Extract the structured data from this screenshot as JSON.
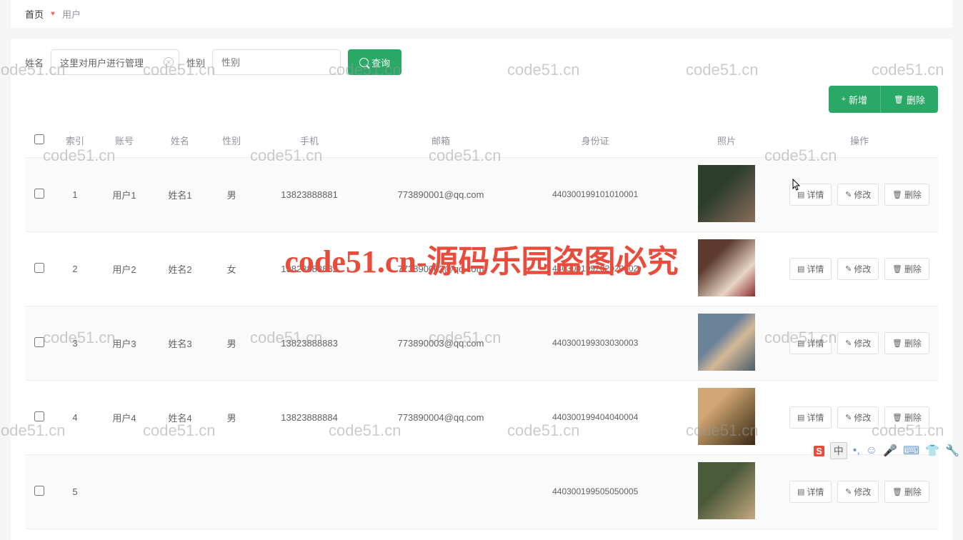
{
  "breadcrumb": {
    "home": "首页",
    "current": "用户"
  },
  "search": {
    "name_label": "姓名",
    "name_value": "这里对用户进行管理",
    "gender_label": "性别",
    "gender_placeholder": "性别",
    "query_btn": "查询"
  },
  "toolbar": {
    "add": "新增",
    "delete": "删除"
  },
  "columns": {
    "index": "索引",
    "account": "账号",
    "name": "姓名",
    "gender": "性别",
    "phone": "手机",
    "email": "邮箱",
    "idcard": "身份证",
    "photo": "照片",
    "action": "操作"
  },
  "row_actions": {
    "detail": "详情",
    "edit": "修改",
    "delete": "删除"
  },
  "rows": [
    {
      "index": "1",
      "account": "用户1",
      "name": "姓名1",
      "gender": "男",
      "phone": "13823888881",
      "email": "773890001@qq.com",
      "idcard": "440300199101010001"
    },
    {
      "index": "2",
      "account": "用户2",
      "name": "姓名2",
      "gender": "女",
      "phone": "13823888882",
      "email": "773890002@qq.com",
      "idcard": "440300199202020002"
    },
    {
      "index": "3",
      "account": "用户3",
      "name": "姓名3",
      "gender": "男",
      "phone": "13823888883",
      "email": "773890003@qq.com",
      "idcard": "440300199303030003"
    },
    {
      "index": "4",
      "account": "用户4",
      "name": "姓名4",
      "gender": "男",
      "phone": "13823888884",
      "email": "773890004@qq.com",
      "idcard": "440300199404040004"
    },
    {
      "index": "5",
      "account": "",
      "name": "",
      "gender": "",
      "phone": "",
      "email": "",
      "idcard": "440300199505050005"
    }
  ],
  "watermark_text": "code51.cn",
  "watermark_big": "code51.cn-源码乐园盗图必究",
  "bottom_bar": {
    "zhong": "中",
    "s": "S"
  }
}
